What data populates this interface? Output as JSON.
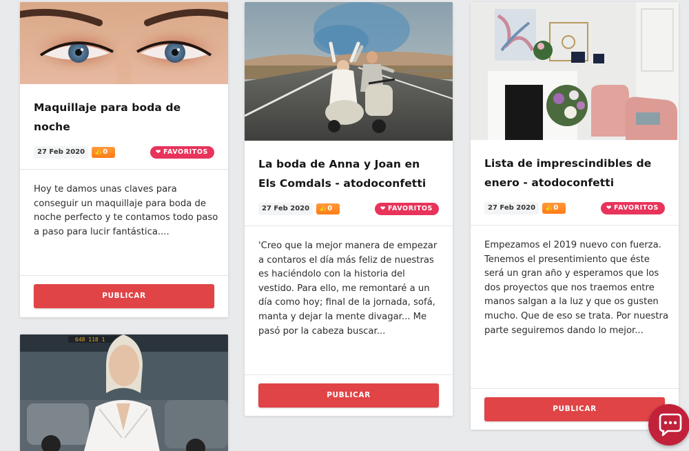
{
  "cards": [
    {
      "title": "Maquillaje para boda de noche",
      "date": "27 Feb 2020",
      "likes": "0",
      "favorites_label": "FAVORITOS",
      "excerpt": "Hoy te damos unas claves para conseguir un maquillaje para boda de noche perfecto y te contamos todo paso a paso para lucir fantástica....",
      "publish_label": "PUBLICAR"
    },
    {
      "title": "La boda de Anna y Joan en Els Comdals - atodoconfetti",
      "date": "27 Feb 2020",
      "likes": "0",
      "favorites_label": "FAVORITOS",
      "excerpt": "'Creo que la mejor manera de empezar a contaros el día más feliz de nuestras es haciéndolo con la historia del vestido. Para ello, me remontaré a un día como hoy; final de la jornada, sofá, manta y dejar la mente divagar... Me pasó por la cabeza buscar...",
      "publish_label": "PUBLICAR"
    },
    {
      "title": "Lista de imprescindibles de enero - atodoconfetti",
      "date": "27 Feb 2020",
      "likes": "0",
      "favorites_label": "FAVORITOS",
      "excerpt": "Empezamos el 2019 nuevo con fuerza. Tenemos el presentimiento que éste será un gran año y esperamos que los dos proyectos que nos traemos entre manos salgan a la luz y que os gusten mucho. Que de eso se trata.  Por nuestra parte seguiremos dando lo mejor...",
      "publish_label": "PUBLICAR"
    }
  ],
  "icons": {
    "thumb": "thumbs-up-icon",
    "heart": "heart-icon",
    "chat": "chat-bubble-icon"
  },
  "colors": {
    "accent_red": "#e04446",
    "favorite_pink": "#e8335b",
    "likes_orange": "#ff8a25",
    "chat_fab": "#c2213a"
  }
}
